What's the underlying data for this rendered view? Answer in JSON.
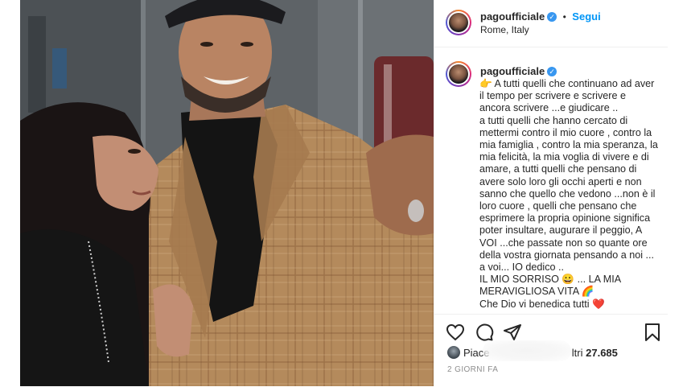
{
  "post": {
    "author": "pagoufficiale",
    "verified_mark": "✓",
    "follow_label": "Segui",
    "separator": "•",
    "location": "Rome, Italy",
    "photo_icon": "selfie-photo"
  },
  "caption": {
    "author": "pagoufficiale",
    "lines": [
      "👉 A tutti quelli che continuano ad aver",
      "il tempo per scrivere e scrivere e",
      "ancora scrivere ...e giudicare ..",
      "a tutti quelli che hanno cercato di",
      "mettermi contro il mio cuore , contro la",
      "mia famiglia , contro la mia speranza, la",
      "mia felicità, la mia voglia di vivere e di",
      "amare, a tutti quelli che pensano di",
      "avere solo loro gli occhi aperti e non",
      "sanno che quello che vedono ...non è il",
      "loro cuore , quelli che pensano che",
      "esprimere la propria opinione significa",
      "poter insultare, augurare il peggio, A",
      "VOI ...che passate non so quante ore",
      "della vostra giornata pensando a noi ...",
      "a voi... IO dedico ..",
      "IL MIO SORRISO 😀 ... LA MIA",
      "MERAVIGLIOSA VITA 🌈",
      "Che Dio vi benedica tutti ❤️"
    ]
  },
  "actions": {
    "like_icon": "heart-icon",
    "comment_icon": "comment-icon",
    "share_icon": "paper-plane-icon",
    "save_icon": "bookmark-icon"
  },
  "likes": {
    "prefix": "Piace",
    "suffix": "ltri",
    "count": "27.685"
  },
  "timestamp": "2 GIORNI FA"
}
